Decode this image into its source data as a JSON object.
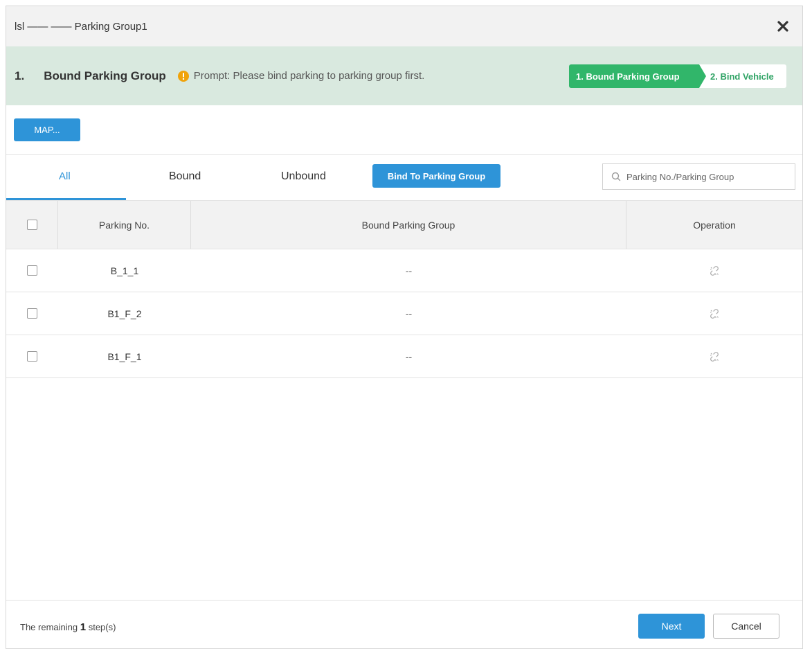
{
  "dialog": {
    "title": "lsl —— —— Parking Group1",
    "close_icon": "close-x-icon"
  },
  "step_header": {
    "number": "1.",
    "title": "Bound Parking Group",
    "prompt_icon": "warning-icon",
    "prompt": "Prompt: Please bind parking to parking group first.",
    "progress": {
      "step1": "1. Bound Parking Group",
      "step2": "2. Bind Vehicle"
    }
  },
  "toolbar": {
    "map_label": "MAP..."
  },
  "tabs": {
    "all": "All",
    "bound": "Bound",
    "unbound": "Unbound",
    "active": "All"
  },
  "bind_button": "Bind To Parking Group",
  "search": {
    "placeholder": "Parking No./Parking Group",
    "value": ""
  },
  "table": {
    "columns": [
      "Parking No.",
      "Bound Parking Group",
      "Operation"
    ],
    "rows": [
      {
        "parking_no": "B_1_1",
        "group": "--",
        "operation_icon": "unbind-link-icon"
      },
      {
        "parking_no": "B1_F_2",
        "group": "--",
        "operation_icon": "unbind-link-icon"
      },
      {
        "parking_no": "B1_F_1",
        "group": "--",
        "operation_icon": "unbind-link-icon"
      }
    ]
  },
  "footer": {
    "remaining_prefix": "The remaining",
    "remaining_count": "1",
    "remaining_suffix": "step(s)",
    "next_label": "Next",
    "cancel_label": "Cancel"
  },
  "colors": {
    "accent": "#2e94d8",
    "step_green": "#31b66a",
    "header_bg": "#d9e9df",
    "warning": "#f0a30a"
  }
}
